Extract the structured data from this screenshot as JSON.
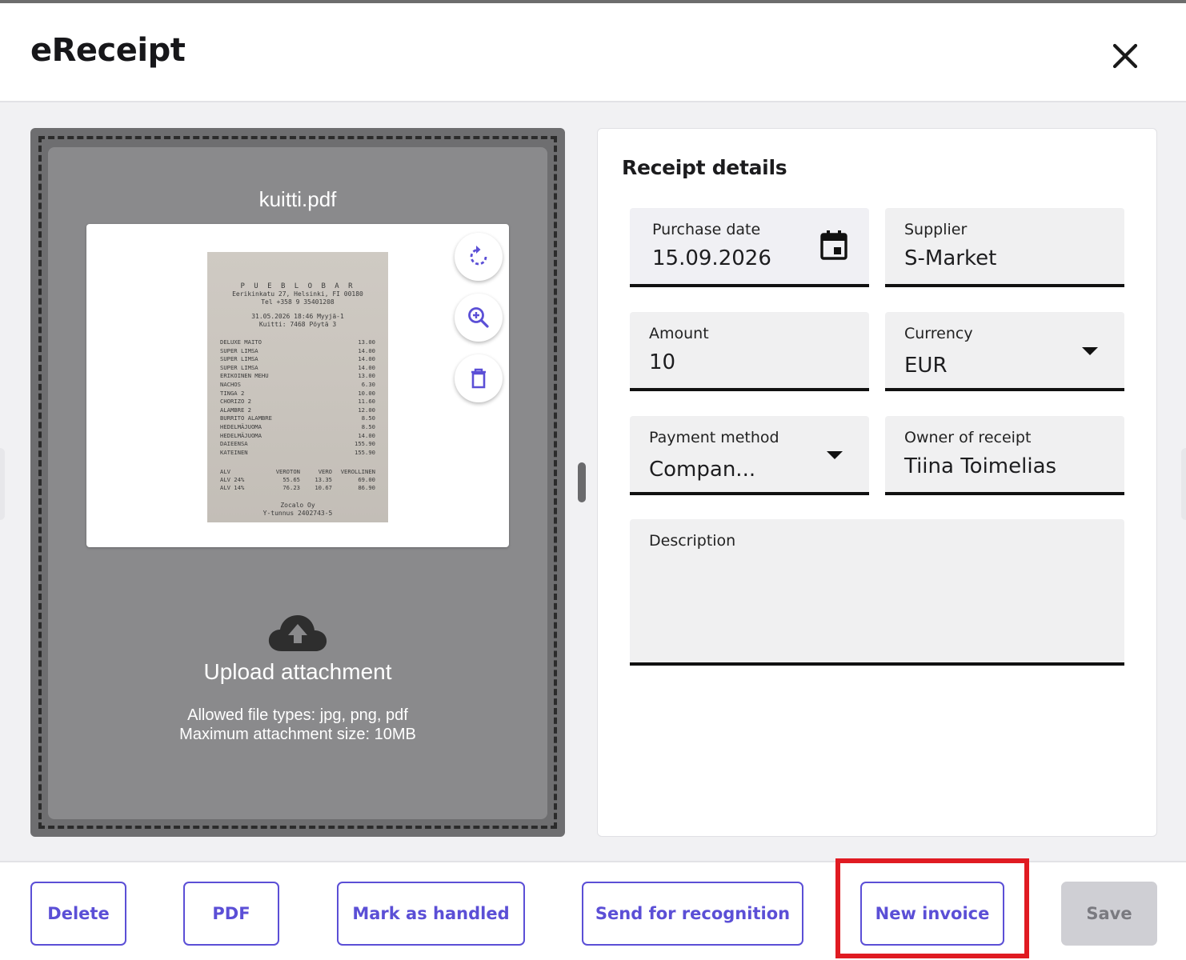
{
  "header": {
    "title": "eReceipt",
    "close_icon": "close-icon"
  },
  "attachment": {
    "filename": "kuitti.pdf",
    "tools": [
      "rotate-icon",
      "zoom-in-icon",
      "trash-icon"
    ],
    "upload_title": "Upload attachment",
    "allowed_types": "Allowed file types: jpg, png, pdf",
    "max_size": "Maximum attachment size: 10MB",
    "receipt": {
      "brand": "P U E B L O   B A R",
      "address": "Eerikinkatu 27, Helsinki, FI 00180",
      "phone": "Tel +358 9 35401208",
      "datetime": "31.05.2026 18:46 Myyjä-1",
      "ticket": "Kuitti: 7468  Pöytä 3",
      "items": [
        {
          "name": "DELUXE MAITO",
          "price": "13.00"
        },
        {
          "name": "SUPER LIMSA",
          "price": "14.00"
        },
        {
          "name": "SUPER LIMSA",
          "price": "14.00"
        },
        {
          "name": "SUPER LIMSA",
          "price": "14.00"
        },
        {
          "name": "ERIKOINEN MEHU",
          "price": "13.00"
        },
        {
          "name": "NACHOS",
          "price": "6.30"
        },
        {
          "name": "TINGA 2",
          "price": "10.00"
        },
        {
          "name": "CHORIZO 2",
          "price": "11.60"
        },
        {
          "name": "ALAMBRE 2",
          "price": "12.00"
        },
        {
          "name": "BURRITO ALAMBRE",
          "price": "8.50"
        },
        {
          "name": "HEDELMÄJUOMA",
          "price": "8.50"
        },
        {
          "name": "HEDELMÄJUOMA",
          "price": "14.00"
        },
        {
          "name": "DAIEENSA",
          "price": "155.90"
        },
        {
          "name": "KATEINEN",
          "price": "155.90"
        }
      ],
      "vat_header": [
        "ALV",
        "VEROTON",
        "VERO",
        "VEROLLINEN"
      ],
      "vat_rows": [
        [
          "ALV 24%",
          "55.65",
          "13.35",
          "69.00"
        ],
        [
          "ALV 14%",
          "76.23",
          "10.67",
          "86.90"
        ]
      ],
      "company": "Zocalo Oy",
      "business_id": "Y-tunnus 2402743-5"
    }
  },
  "details": {
    "title": "Receipt details",
    "purchase_date": {
      "label": "Purchase date",
      "value": "15.09.2026",
      "icon": "calendar-icon"
    },
    "supplier": {
      "label": "Supplier",
      "value": "S-Market"
    },
    "amount": {
      "label": "Amount",
      "value": "10"
    },
    "currency": {
      "label": "Currency",
      "value": "EUR",
      "icon": "chevron-down-icon"
    },
    "payment_method": {
      "label": "Payment method",
      "value": "Compan...",
      "icon": "chevron-down-icon"
    },
    "owner": {
      "label": "Owner of receipt",
      "value": "Tiina Toimelias"
    },
    "description": {
      "label": "Description",
      "value": ""
    }
  },
  "footer": {
    "delete": "Delete",
    "pdf": "PDF",
    "mark_handled": "Mark as handled",
    "send_recognition": "Send for recognition",
    "new_invoice": "New invoice",
    "save": "Save"
  },
  "colors": {
    "accent": "#5b4fd6",
    "highlight": "#e01b22",
    "dropzone": "#6e6e70",
    "save_disabled": "#cfcfd4"
  }
}
